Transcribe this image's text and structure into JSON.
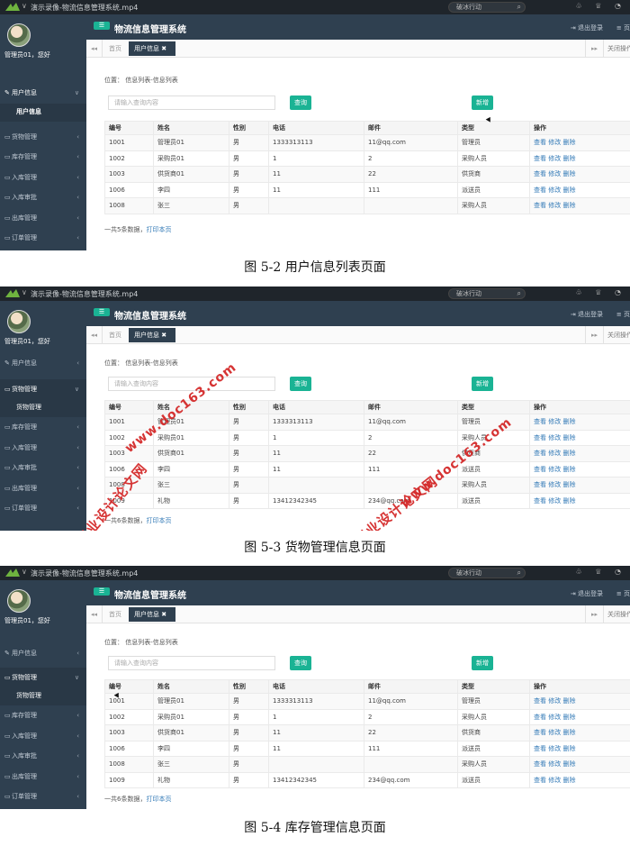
{
  "window": {
    "title": "演示录像-物流信息管理系统.mp4",
    "search_label": "破冰行动"
  },
  "app": {
    "system_name": "物流信息管理系统",
    "greeting": "管理员01，您好",
    "logout": "退出登录",
    "page_label": "页",
    "menu_toggle": "☰"
  },
  "tabs": {
    "home": "首页",
    "active": "用户信息",
    "close_ops": "关闭操作"
  },
  "breadcrumb": {
    "prefix": "位置：",
    "path": "信息列表-信息列表"
  },
  "search": {
    "placeholder": "请输入查询内容",
    "query_button": "查询",
    "add_button": "新增"
  },
  "table_headers": [
    "编号",
    "姓名",
    "性别",
    "电话",
    "邮件",
    "类型",
    "操作"
  ],
  "row_actions": "查看 修改 删除",
  "rows_5": [
    [
      "1001",
      "管理员01",
      "男",
      "1333313113",
      "11@qq.com",
      "管理员"
    ],
    [
      "1002",
      "采购员01",
      "男",
      "1",
      "2",
      "采购人员"
    ],
    [
      "1003",
      "供货商01",
      "男",
      "11",
      "22",
      "供货商"
    ],
    [
      "1006",
      "李四",
      "男",
      "11",
      "111",
      "派送员"
    ],
    [
      "1008",
      "张三",
      "男",
      "",
      "",
      "采购人员"
    ]
  ],
  "rows_6": [
    [
      "1001",
      "管理员01",
      "男",
      "1333313113",
      "11@qq.com",
      "管理员"
    ],
    [
      "1002",
      "采购员01",
      "男",
      "1",
      "2",
      "采购人员"
    ],
    [
      "1003",
      "供货商01",
      "男",
      "11",
      "22",
      "供货商"
    ],
    [
      "1006",
      "李四",
      "男",
      "11",
      "111",
      "派送员"
    ],
    [
      "1008",
      "张三",
      "男",
      "",
      "",
      "采购人员"
    ],
    [
      "1009",
      "礼物",
      "男",
      "13412342345",
      "234@qq.com",
      "派送员"
    ]
  ],
  "footer_5": {
    "count": "一共5条数据，",
    "print": "打印本页"
  },
  "footer_6": {
    "count": "一共6条数据，",
    "print": "打印本页"
  },
  "menu": {
    "user_info": "用户信息",
    "user_info_sub": "用户信息",
    "goods": "货物管理",
    "goods_sub": "货物管理",
    "stock": "库存管理",
    "inbound": "入库管理",
    "inbound_audit": "入库审批",
    "outbound": "出库管理",
    "orders": "订单管理"
  },
  "captions": {
    "fig1": "图 5-2 用户信息列表页面",
    "fig2": "图 5-3 货物管理信息页面",
    "fig3": "图 5-4 库存管理信息页面"
  },
  "watermark": {
    "site": "www.doc163.com",
    "cn": "毕业设计论文网"
  },
  "colors": {
    "sidebar": "#2f4050",
    "accent": "#1ab394",
    "link": "#337ab7",
    "watermark": "#d42a2a"
  }
}
